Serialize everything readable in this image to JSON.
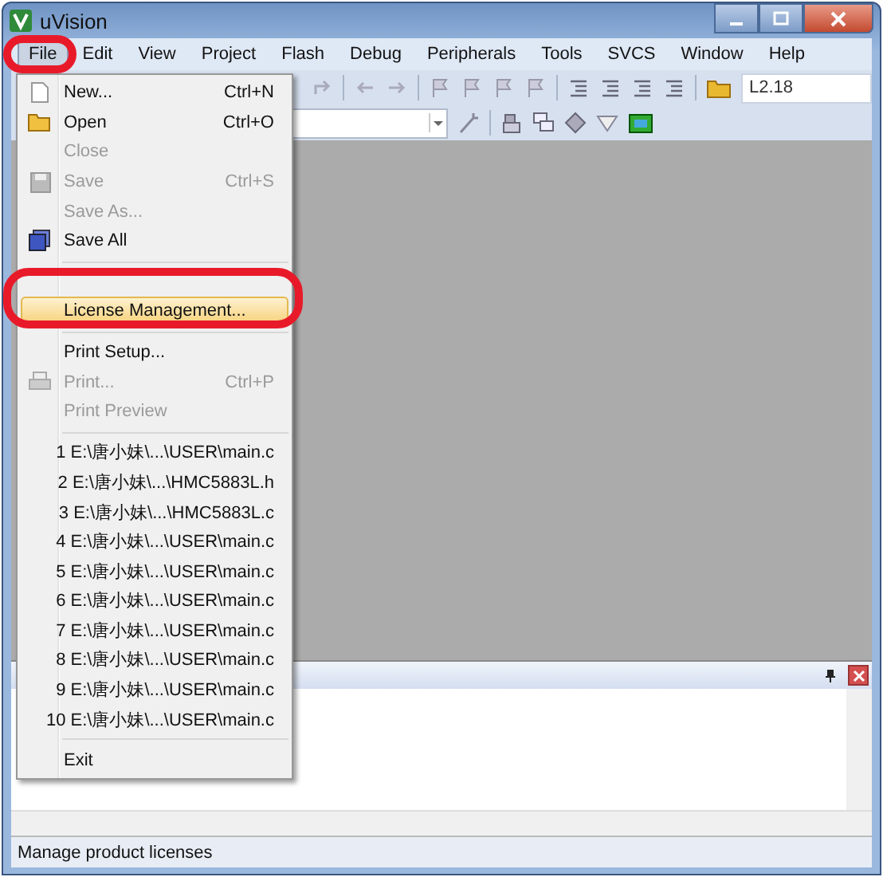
{
  "window": {
    "title": "uVision"
  },
  "menu_bar": [
    {
      "label": "File",
      "selected": true
    },
    {
      "label": "Edit",
      "selected": false
    },
    {
      "label": "View",
      "selected": false
    },
    {
      "label": "Project",
      "selected": false
    },
    {
      "label": "Flash",
      "selected": false
    },
    {
      "label": "Debug",
      "selected": false
    },
    {
      "label": "Peripherals",
      "selected": false
    },
    {
      "label": "Tools",
      "selected": false
    },
    {
      "label": "SVCS",
      "selected": false
    },
    {
      "label": "Window",
      "selected": false
    },
    {
      "label": "Help",
      "selected": false
    }
  ],
  "toolbar": {
    "find_field": "L2.18"
  },
  "file_menu": [
    {
      "kind": "item",
      "label": "New...",
      "shortcut": "Ctrl+N",
      "disabled": false,
      "selected": false
    },
    {
      "kind": "item",
      "label": "Open",
      "shortcut": "Ctrl+O",
      "disabled": false,
      "selected": false
    },
    {
      "kind": "item",
      "label": "Close",
      "disabled": true,
      "selected": false
    },
    {
      "kind": "item",
      "label": "Save",
      "shortcut": "Ctrl+S",
      "disabled": true,
      "selected": false
    },
    {
      "kind": "item",
      "label": "Save As...",
      "disabled": true,
      "selected": false
    },
    {
      "kind": "item",
      "label": "Save All",
      "disabled": false,
      "selected": false
    },
    {
      "kind": "separator"
    },
    {
      "kind": "covered"
    },
    {
      "kind": "item",
      "label": "License Management...",
      "disabled": false,
      "selected": true
    },
    {
      "kind": "separator"
    },
    {
      "kind": "item",
      "label": "Print Setup...",
      "disabled": false,
      "selected": false
    },
    {
      "kind": "item",
      "label": "Print...",
      "shortcut": "Ctrl+P",
      "disabled": true,
      "selected": false
    },
    {
      "kind": "item",
      "label": "Print Preview",
      "disabled": true,
      "selected": false
    },
    {
      "kind": "separator"
    },
    {
      "kind": "item",
      "label": "1 E:\\唐小妹\\...\\USER\\main.c",
      "disabled": false,
      "selected": false
    },
    {
      "kind": "item",
      "label": "2 E:\\唐小妹\\...\\HMC5883L.h",
      "disabled": false,
      "selected": false
    },
    {
      "kind": "item",
      "label": "3 E:\\唐小妹\\...\\HMC5883L.c",
      "disabled": false,
      "selected": false
    },
    {
      "kind": "item",
      "label": "4 E:\\唐小妹\\...\\USER\\main.c",
      "disabled": false,
      "selected": false
    },
    {
      "kind": "item",
      "label": "5 E:\\唐小妹\\...\\USER\\main.c",
      "disabled": false,
      "selected": false
    },
    {
      "kind": "item",
      "label": "6 E:\\唐小妹\\...\\USER\\main.c",
      "disabled": false,
      "selected": false
    },
    {
      "kind": "item",
      "label": "7 E:\\唐小妹\\...\\USER\\main.c",
      "disabled": false,
      "selected": false
    },
    {
      "kind": "item",
      "label": "8 E:\\唐小妹\\...\\USER\\main.c",
      "disabled": false,
      "selected": false
    },
    {
      "kind": "item",
      "label": "9 E:\\唐小妹\\...\\USER\\main.c",
      "disabled": false,
      "selected": false
    },
    {
      "kind": "item",
      "label": "10 E:\\唐小妹\\...\\USER\\main.c",
      "disabled": false,
      "selected": false
    },
    {
      "kind": "separator"
    },
    {
      "kind": "item",
      "label": "Exit",
      "disabled": false,
      "selected": false
    }
  ],
  "status_bar": "Manage product licenses"
}
